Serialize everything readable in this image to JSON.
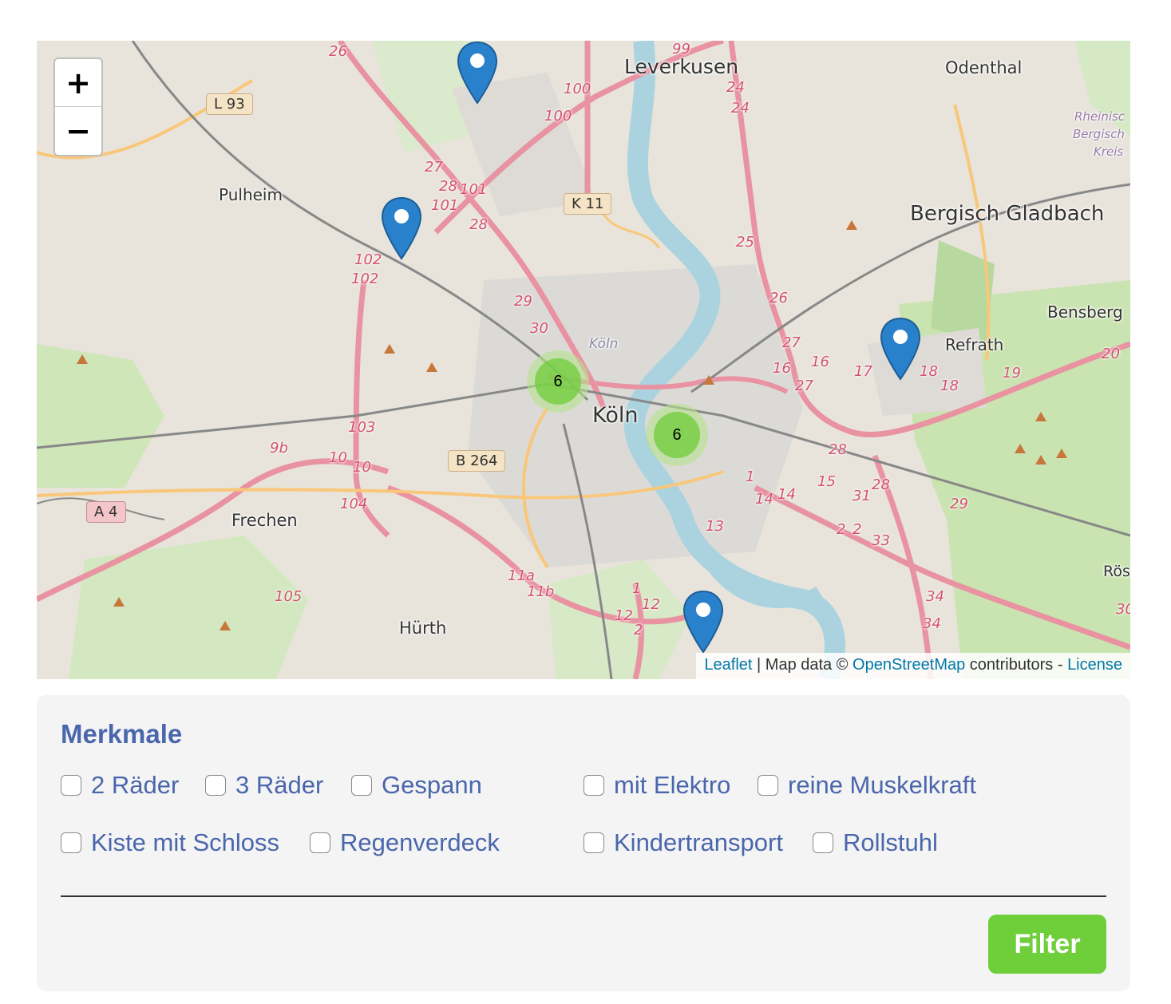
{
  "map": {
    "zoom_in_label": "+",
    "zoom_out_label": "−",
    "place_labels": {
      "leverkusen": "Leverkusen",
      "odenthal": "Odenthal",
      "pulheim": "Pulheim",
      "bergisch_gladbach": "Bergisch Gladbach",
      "bensberg": "Bensberg",
      "refrath": "Refrath",
      "koeln_small": "Köln",
      "koeln": "Köln",
      "frechen": "Frechen",
      "huerth": "Hürth",
      "rheinisch": "Rheinisc",
      "bergisch": "Bergisch",
      "kreis": "Kreis",
      "roes": "Rös"
    },
    "road_shields": {
      "l93": "L 93",
      "k11": "K 11",
      "b264": "B 264",
      "a4": "A 4"
    },
    "clusters": [
      {
        "count": "6"
      },
      {
        "count": "6"
      }
    ],
    "attribution": {
      "leaflet": "Leaflet",
      "sep": " | Map data © ",
      "osm": "OpenStreetMap",
      "contributors": " contributors - ",
      "license": "License"
    }
  },
  "filters": {
    "heading": "Merkmale",
    "options": [
      "2 Räder",
      "3 Räder",
      "Gespann",
      "mit Elektro",
      "reine Muskelkraft",
      "Kiste mit Schloss",
      "Regenverdeck",
      "Kindertransport",
      "Rollstuhl"
    ],
    "button_label": "Filter"
  },
  "colors": {
    "accent_text": "#4a66ac",
    "button": "#6fcf3a",
    "link": "#0078a8"
  }
}
